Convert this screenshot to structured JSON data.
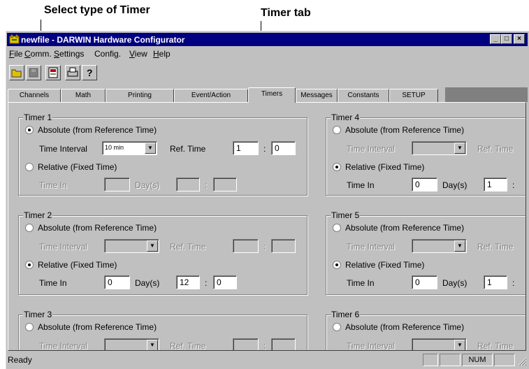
{
  "callouts": {
    "select_timer": "Select type of Timer",
    "timer_tab": "Timer tab"
  },
  "window": {
    "title": "newfile - DARWIN Hardware Configurator",
    "minimize": "_",
    "maximize": "□",
    "close": "×"
  },
  "menu": {
    "items": [
      {
        "label": "File",
        "mnemonic": "F"
      },
      {
        "label": "Comm.",
        "mnemonic": "C"
      },
      {
        "label": "Settings",
        "mnemonic": "S"
      },
      {
        "label": "Config.",
        "mnemonic": "g"
      },
      {
        "label": "View",
        "mnemonic": "V"
      },
      {
        "label": "Help",
        "mnemonic": "H"
      }
    ]
  },
  "toolbar": {
    "buttons": [
      "open-folder-icon",
      "save-disk-icon",
      "configure-icon",
      "print-icon",
      "help-icon"
    ]
  },
  "tabs": [
    "Channels",
    "Math",
    "Printing",
    "Event/Action",
    "Timers",
    "Messages",
    "Constants",
    "SETUP"
  ],
  "active_tab": "Timers",
  "labels": {
    "absolute": "Absolute (from Reference Time)",
    "relative": "Relative (Fixed Time)",
    "time_interval": "Time Interval",
    "ref_time": "Ref. Time",
    "time_in": "Time In",
    "days": "Day(s)",
    "colon": ":"
  },
  "timers": [
    {
      "title": "Timer 1",
      "mode": "absolute",
      "interval": "10 min",
      "ref_hour": "1",
      "ref_min": "0",
      "days": "",
      "hours": "",
      "minutes": ""
    },
    {
      "title": "Timer 2",
      "mode": "relative",
      "interval": "",
      "ref_hour": "",
      "ref_min": "",
      "days": "0",
      "hours": "12",
      "minutes": "0"
    },
    {
      "title": "Timer 3",
      "mode": "absolute",
      "interval": "",
      "ref_hour": "",
      "ref_min": "",
      "days": "",
      "hours": "",
      "minutes": ""
    },
    {
      "title": "Timer 4",
      "mode": "relative",
      "interval": "",
      "ref_hour": "",
      "ref_min": "",
      "days": "0",
      "hours": "1",
      "minutes": ""
    },
    {
      "title": "Timer 5",
      "mode": "relative",
      "interval": "",
      "ref_hour": "",
      "ref_min": "",
      "days": "0",
      "hours": "1",
      "minutes": ""
    },
    {
      "title": "Timer 6",
      "mode": "absolute",
      "interval": "",
      "ref_hour": "",
      "ref_min": "",
      "days": "",
      "hours": "",
      "minutes": ""
    }
  ],
  "status": {
    "text": "Ready",
    "num": "NUM"
  }
}
